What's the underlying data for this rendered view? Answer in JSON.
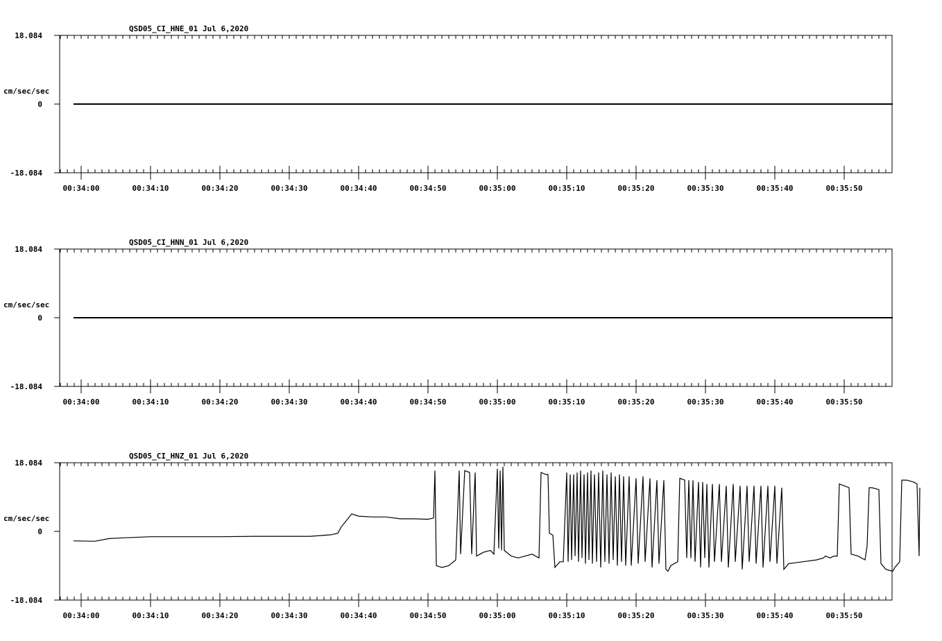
{
  "chart_data": [
    {
      "type": "line",
      "title": "QSD05_CI_HNE_01  Jul 6,2020",
      "ylabel": "cm/sec/sec",
      "ytick_labels": [
        "18.084",
        "0",
        "-18.084"
      ],
      "ylim": [
        -18.084,
        18.084
      ],
      "xtick_labels": [
        "00:34:00",
        "00:34:10",
        "00:34:20",
        "00:34:30",
        "00:34:40",
        "00:34:50",
        "00:35:00",
        "00:35:10",
        "00:35:20",
        "00:35:30",
        "00:35:40",
        "00:35:50"
      ],
      "x_start_s": -1.1,
      "x_end_s": 117.0,
      "series": [
        {
          "values": [
            [
              -1.1,
              0
            ],
            [
              117.0,
              0
            ]
          ]
        }
      ]
    },
    {
      "type": "line",
      "title": "QSD05_CI_HNN_01  Jul 6,2020",
      "ylabel": "cm/sec/sec",
      "ytick_labels": [
        "18.084",
        "0",
        "-18.084"
      ],
      "ylim": [
        -18.084,
        18.084
      ],
      "xtick_labels": [
        "00:34:00",
        "00:34:10",
        "00:34:20",
        "00:34:30",
        "00:34:40",
        "00:34:50",
        "00:35:00",
        "00:35:10",
        "00:35:20",
        "00:35:30",
        "00:35:40",
        "00:35:50"
      ],
      "x_start_s": -1.1,
      "x_end_s": 117.0,
      "series": [
        {
          "values": [
            [
              -1.1,
              0
            ],
            [
              117.0,
              0
            ]
          ]
        }
      ]
    },
    {
      "type": "line",
      "title": "QSD05_CI_HNZ_01  Jul 6,2020",
      "ylabel": "cm/sec/sec",
      "ytick_labels": [
        "18.084",
        "0",
        "-18.084"
      ],
      "ylim": [
        -18.084,
        18.084
      ],
      "xtick_labels": [
        "00:34:00",
        "00:34:10",
        "00:34:20",
        "00:34:30",
        "00:34:40",
        "00:34:50",
        "00:35:00",
        "00:35:10",
        "00:35:20",
        "00:35:30",
        "00:35:40",
        "00:35:50"
      ],
      "x_start_s": -1.1,
      "x_end_s": 117.0,
      "series": [
        {
          "values": [
            [
              -1.1,
              -2.5
            ],
            [
              2.0,
              -2.6
            ],
            [
              4.0,
              -1.9
            ],
            [
              6.0,
              -1.7
            ],
            [
              10.0,
              -1.4
            ],
            [
              15.0,
              -1.4
            ],
            [
              20.0,
              -1.4
            ],
            [
              25.0,
              -1.3
            ],
            [
              30.0,
              -1.3
            ],
            [
              33.0,
              -1.3
            ],
            [
              36.0,
              -0.9
            ],
            [
              37.0,
              -0.5
            ],
            [
              37.5,
              1.2
            ],
            [
              38.0,
              2.3
            ],
            [
              39.0,
              4.6
            ],
            [
              40.0,
              4.0
            ],
            [
              42.0,
              3.8
            ],
            [
              44.0,
              3.8
            ],
            [
              46.0,
              3.3
            ],
            [
              48.0,
              3.3
            ],
            [
              50.0,
              3.2
            ],
            [
              50.8,
              3.5
            ],
            [
              51.0,
              16.0
            ],
            [
              51.2,
              -9.0
            ],
            [
              52.0,
              -9.5
            ],
            [
              53.0,
              -9.0
            ],
            [
              54.0,
              -7.5
            ],
            [
              54.5,
              16.0
            ],
            [
              54.7,
              -6.0
            ],
            [
              55.3,
              16.0
            ],
            [
              56.0,
              15.5
            ],
            [
              56.3,
              -6.0
            ],
            [
              56.8,
              15.5
            ],
            [
              57.0,
              -6.5
            ],
            [
              57.5,
              -6.0
            ],
            [
              58.0,
              -5.5
            ],
            [
              59.0,
              -5.0
            ],
            [
              59.5,
              -6.0
            ],
            [
              60.0,
              16.5
            ],
            [
              60.2,
              -4.5
            ],
            [
              60.4,
              16.0
            ],
            [
              60.6,
              -5.0
            ],
            [
              60.8,
              17.0
            ],
            [
              61.0,
              -5.0
            ],
            [
              62.0,
              -6.5
            ],
            [
              63.0,
              -7.0
            ],
            [
              64.0,
              -6.5
            ],
            [
              65.0,
              -6.0
            ],
            [
              66.0,
              -7.0
            ],
            [
              66.3,
              15.5
            ],
            [
              67.0,
              15.0
            ],
            [
              67.3,
              15.0
            ],
            [
              67.5,
              -0.5
            ],
            [
              68.0,
              -1.0
            ],
            [
              68.3,
              -9.5
            ],
            [
              69.0,
              -8.0
            ],
            [
              69.5,
              -8.0
            ],
            [
              70.0,
              15.5
            ],
            [
              70.2,
              -8.0
            ],
            [
              70.5,
              15.0
            ],
            [
              70.7,
              -7.5
            ],
            [
              71.0,
              15.0
            ],
            [
              71.2,
              -6.5
            ],
            [
              71.5,
              15.5
            ],
            [
              71.7,
              -8.0
            ],
            [
              72.0,
              16.0
            ],
            [
              72.2,
              -7.0
            ],
            [
              72.5,
              15.0
            ],
            [
              72.7,
              -8.5
            ],
            [
              73.0,
              15.5
            ],
            [
              73.2,
              -7.5
            ],
            [
              73.5,
              16.0
            ],
            [
              73.7,
              -8.5
            ],
            [
              74.0,
              15.0
            ],
            [
              74.3,
              -8.0
            ],
            [
              74.6,
              15.5
            ],
            [
              74.9,
              -9.5
            ],
            [
              75.2,
              16.0
            ],
            [
              75.5,
              -8.0
            ],
            [
              75.8,
              15.0
            ],
            [
              76.1,
              -8.5
            ],
            [
              76.4,
              15.5
            ],
            [
              76.7,
              -7.5
            ],
            [
              77.0,
              14.5
            ],
            [
              77.3,
              -9.0
            ],
            [
              77.6,
              15.0
            ],
            [
              77.9,
              -8.0
            ],
            [
              78.2,
              14.5
            ],
            [
              78.5,
              -9.0
            ],
            [
              79.0,
              14.5
            ],
            [
              79.3,
              -9.0
            ],
            [
              80.0,
              14.0
            ],
            [
              80.3,
              -8.5
            ],
            [
              81.0,
              14.5
            ],
            [
              81.3,
              -8.0
            ],
            [
              82.0,
              14.0
            ],
            [
              82.3,
              -9.5
            ],
            [
              83.0,
              13.5
            ],
            [
              83.3,
              -8.5
            ],
            [
              84.0,
              13.5
            ],
            [
              84.3,
              -10.0
            ],
            [
              84.6,
              -10.5
            ],
            [
              85.0,
              -9.0
            ],
            [
              86.0,
              -8.0
            ],
            [
              86.3,
              14.0
            ],
            [
              87.0,
              13.5
            ],
            [
              87.3,
              -7.0
            ],
            [
              87.6,
              13.5
            ],
            [
              87.9,
              -7.0
            ],
            [
              88.2,
              13.5
            ],
            [
              88.5,
              -8.0
            ],
            [
              89.0,
              13.0
            ],
            [
              89.3,
              -9.5
            ],
            [
              89.6,
              13.0
            ],
            [
              89.9,
              -7.0
            ],
            [
              90.2,
              12.5
            ],
            [
              90.5,
              -9.5
            ],
            [
              91.0,
              12.5
            ],
            [
              91.3,
              -8.0
            ],
            [
              92.0,
              12.5
            ],
            [
              92.3,
              -8.0
            ],
            [
              93.0,
              12.0
            ],
            [
              93.3,
              -9.5
            ],
            [
              94.0,
              12.5
            ],
            [
              94.3,
              -8.0
            ],
            [
              95.0,
              12.0
            ],
            [
              95.3,
              -10.0
            ],
            [
              96.0,
              12.0
            ],
            [
              96.3,
              -8.0
            ],
            [
              97.0,
              12.0
            ],
            [
              97.3,
              -8.5
            ],
            [
              98.0,
              12.0
            ],
            [
              98.3,
              -9.5
            ],
            [
              99.0,
              12.0
            ],
            [
              99.3,
              -8.0
            ],
            [
              100.0,
              12.0
            ],
            [
              100.3,
              -8.5
            ],
            [
              101.0,
              11.5
            ],
            [
              101.3,
              -10.0
            ],
            [
              102.0,
              -8.5
            ],
            [
              104.0,
              -8.0
            ],
            [
              106.0,
              -7.5
            ],
            [
              107.0,
              -7.0
            ],
            [
              107.3,
              -6.5
            ],
            [
              108.0,
              -7.0
            ],
            [
              108.5,
              -6.5
            ],
            [
              109.0,
              -6.5
            ],
            [
              109.3,
              12.5
            ],
            [
              110.0,
              12.0
            ],
            [
              110.7,
              11.5
            ],
            [
              111.0,
              -6.0
            ],
            [
              112.0,
              -6.5
            ],
            [
              113.0,
              -7.5
            ],
            [
              113.3,
              -4.0
            ],
            [
              113.6,
              11.5
            ],
            [
              114.0,
              11.5
            ],
            [
              115.0,
              11.0
            ],
            [
              115.3,
              -8.5
            ],
            [
              116.0,
              -10.0
            ],
            [
              117.0,
              -10.5
            ],
            [
              117.3,
              -9.5
            ],
            [
              118.0,
              -8.0
            ],
            [
              118.3,
              13.5
            ],
            [
              119.0,
              13.5
            ],
            [
              120.0,
              13.0
            ],
            [
              120.5,
              12.5
            ],
            [
              120.8,
              -6.5
            ],
            [
              120.9,
              11.5
            ]
          ]
        }
      ]
    }
  ]
}
